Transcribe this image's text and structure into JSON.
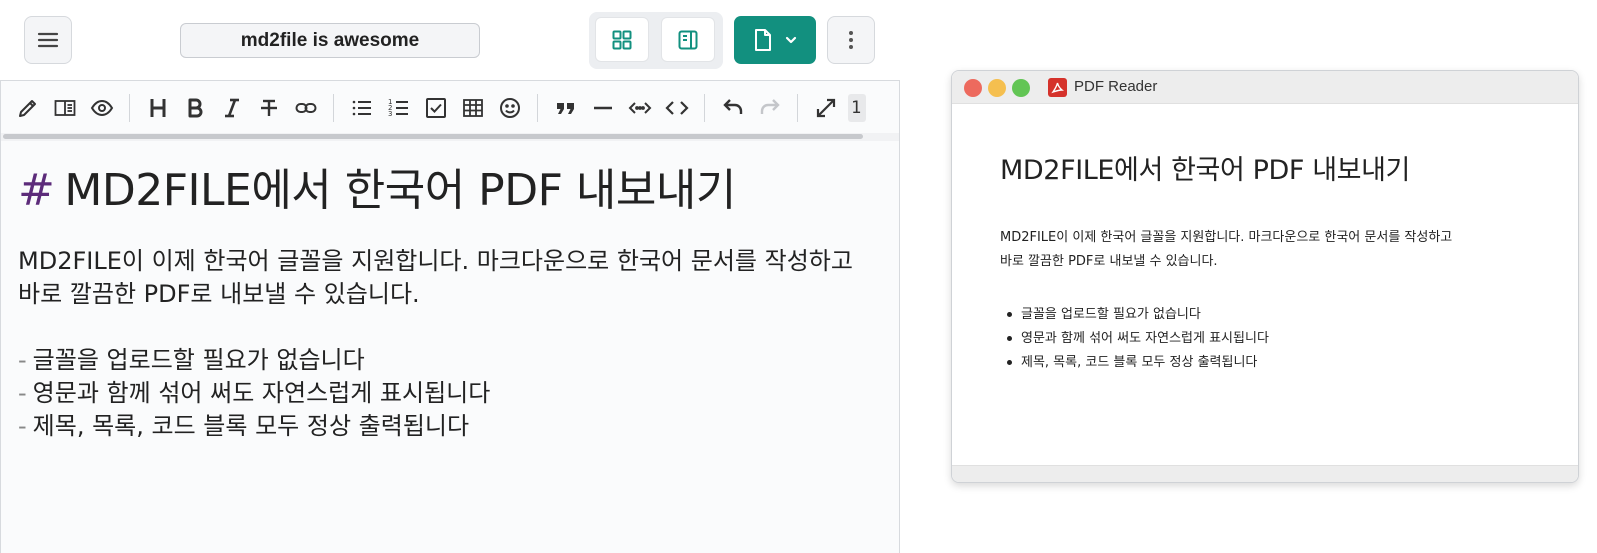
{
  "header": {
    "doc_title": "md2file is awesome",
    "icons": {
      "menu": "menu-icon",
      "grid_view": "grid-view-icon",
      "split_view": "split-view-icon",
      "export": "file-icon",
      "more": "more-vertical-icon"
    },
    "accent_color": "#12907f"
  },
  "editor": {
    "toolbar": [
      "pencil-icon",
      "side-by-side-icon",
      "eye-icon",
      "heading-icon",
      "bold-icon",
      "italic-icon",
      "strikethrough-icon",
      "link-icon",
      "bullet-list-icon",
      "numbered-list-icon",
      "checklist-icon",
      "table-icon",
      "emoji-icon",
      "quote-icon",
      "horizontal-rule-icon",
      "inline-code-icon",
      "code-block-icon",
      "undo-icon",
      "redo-icon",
      "fullscreen-icon"
    ],
    "toolbar_overflow": "1",
    "heading_marker": "#",
    "heading": "MD2FILE에서 한국어 PDF 내보내기",
    "paragraph_line1": "MD2FILE이 이제 한국어 글꼴을 지원합니다. 마크다운으로 한국어 문서를 작성하고",
    "paragraph_line2": "바로 깔끔한 PDF로 내보낼 수 있습니다.",
    "list_marker": "-",
    "list": [
      "글꼴을 업로드할 필요가 없습니다",
      "영문과 함께 섞어 써도 자연스럽게 표시됩니다",
      "제목, 목록, 코드 블록 모두 정상 출력됩니다"
    ]
  },
  "pdf_reader": {
    "window_title": "PDF Reader",
    "traffic_light_colors": [
      "#ed6a5e",
      "#f5bf4f",
      "#62c554"
    ],
    "heading": "MD2FILE에서 한국어 PDF 내보내기",
    "paragraph_line1": "MD2FILE이 이제 한국어 글꼴을 지원합니다. 마크다운으로 한국어 문서를 작성하고",
    "paragraph_line2": "바로 깔끔한 PDF로 내보낼 수 있습니다.",
    "list": [
      "글꼴을 업로드할 필요가 없습니다",
      "영문과 함께 섞어 써도 자연스럽게 표시됩니다",
      "제목, 목록, 코드 블록 모두 정상 출력됩니다"
    ]
  }
}
